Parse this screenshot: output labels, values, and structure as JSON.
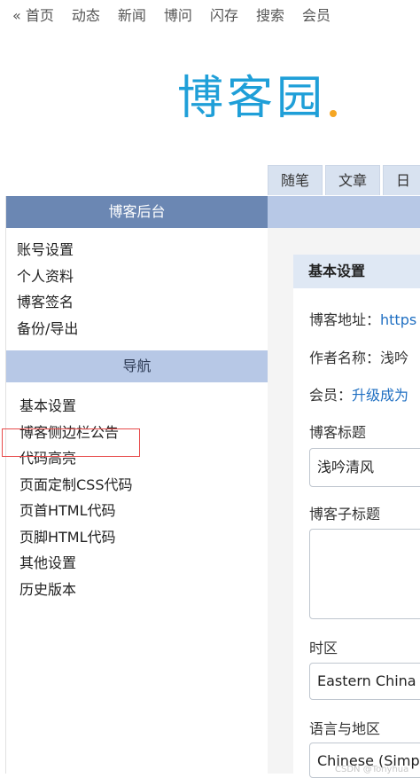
{
  "topnav": {
    "items": [
      "« 首页",
      "动态",
      "新闻",
      "博问",
      "闪存",
      "搜索",
      "会员"
    ]
  },
  "logo": {
    "text": "博客园"
  },
  "tabs": [
    "随笔",
    "文章",
    "日"
  ],
  "sidebar": {
    "admin_title": "博客后台",
    "account_links": [
      "账号设置",
      "个人资料",
      "博客签名",
      "备份/导出"
    ],
    "nav_title": "导航",
    "nav_links": [
      "基本设置",
      "博客侧边栏公告",
      "代码高亮",
      "页面定制CSS代码",
      "页首HTML代码",
      "页脚HTML代码",
      "其他设置",
      "历史版本"
    ]
  },
  "panel": {
    "title": "基本设置",
    "blog_address_label": "博客地址：",
    "blog_address_value": "https",
    "author_label": "作者名称：",
    "author_value": "浅吟",
    "member_label": "会员：",
    "member_link": "升级成为",
    "blog_title_label": "博客标题",
    "blog_title_value": "浅吟清风",
    "subtitle_label": "博客子标题",
    "timezone_label": "时区",
    "timezone_value": "Eastern China",
    "locale_label": "语言与地区",
    "locale_value": "Chinese (Simp"
  },
  "watermark": "CSDN @Tonyhua",
  "colors": {
    "accent": "#1f9fd8",
    "header_dark": "#6b87b3",
    "header_light": "#b7c8e6",
    "highlight": "#e74a4a"
  }
}
